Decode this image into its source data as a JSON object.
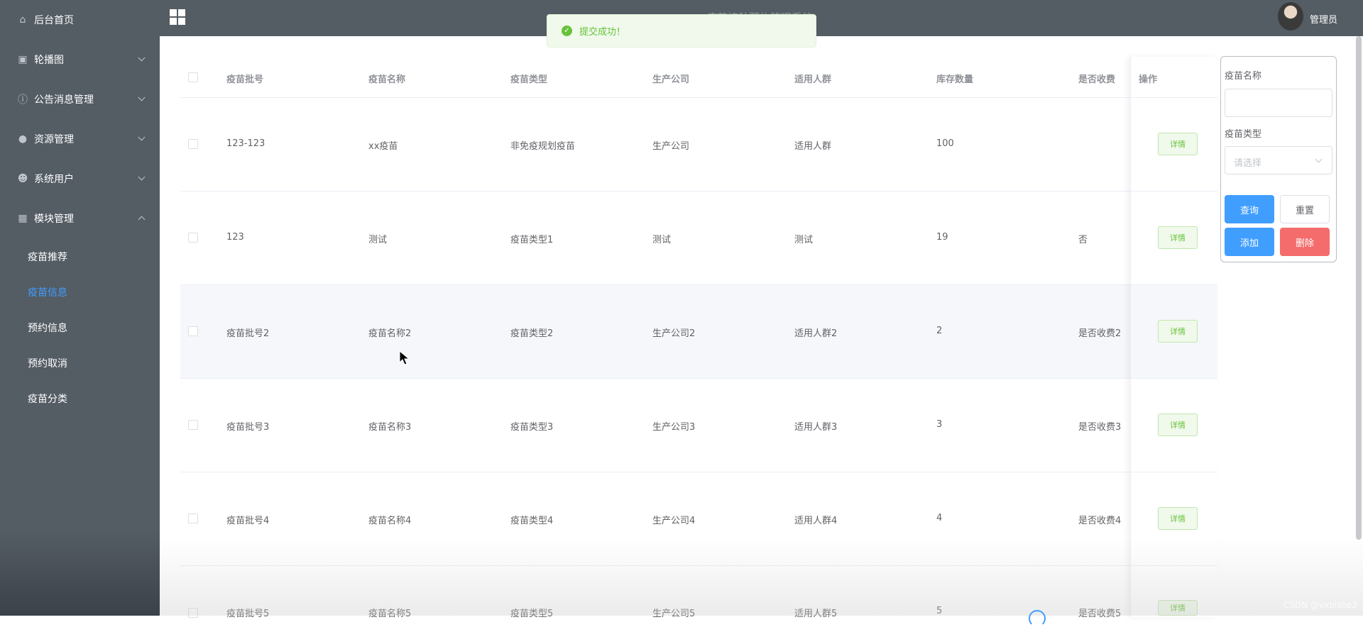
{
  "sidebar": {
    "menu": [
      {
        "label": "后台首页",
        "icon": "home-icon"
      },
      {
        "label": "轮播图",
        "icon": "image-icon"
      },
      {
        "label": "公告消息管理",
        "icon": "info-icon"
      },
      {
        "label": "资源管理",
        "icon": "location-icon"
      },
      {
        "label": "系统用户",
        "icon": "user-icon"
      },
      {
        "label": "模块管理",
        "icon": "grid-icon"
      }
    ],
    "submenu": [
      {
        "label": "疫苗推荐"
      },
      {
        "label": "疫苗信息"
      },
      {
        "label": "预约信息"
      },
      {
        "label": "预约取消"
      },
      {
        "label": "疫苗分类"
      }
    ]
  },
  "header": {
    "title": "疫苗接种预约管理系统",
    "username": "管理员"
  },
  "toast": {
    "message": "提交成功！"
  },
  "table": {
    "headers": [
      "疫苗批号",
      "疫苗名称",
      "疫苗类型",
      "生产公司",
      "适用人群",
      "库存数量",
      "是否收费",
      "操作"
    ],
    "detail_label": "详情",
    "rows": [
      [
        "123-123",
        "xx疫苗",
        "非免疫规划疫苗",
        "生产公司",
        "适用人群",
        "100",
        ""
      ],
      [
        "123",
        "测试",
        "疫苗类型1",
        "测试",
        "测试",
        "19",
        "否"
      ],
      [
        "疫苗批号2",
        "疫苗名称2",
        "疫苗类型2",
        "生产公司2",
        "适用人群2",
        "2",
        "是否收费2"
      ],
      [
        "疫苗批号3",
        "疫苗名称3",
        "疫苗类型3",
        "生产公司3",
        "适用人群3",
        "3",
        "是否收费3"
      ],
      [
        "疫苗批号4",
        "疫苗名称4",
        "疫苗类型4",
        "生产公司4",
        "适用人群4",
        "4",
        "是否收费4"
      ],
      [
        "疫苗批号5",
        "疫苗名称5",
        "疫苗类型5",
        "生产公司5",
        "适用人群5",
        "5",
        "是否收费5"
      ]
    ]
  },
  "search": {
    "name_label": "疫苗名称",
    "name_value": "",
    "type_label": "疫苗类型",
    "type_placeholder": "请选择",
    "query_label": "查询",
    "reset_label": "重置",
    "add_label": "添加",
    "delete_label": "删除"
  },
  "watermark": "CSDN @vxbishe2",
  "colors": {
    "primary": "#409eff",
    "success": "#67c23a",
    "danger": "#f56c6c",
    "sidebar": "#545c64"
  }
}
